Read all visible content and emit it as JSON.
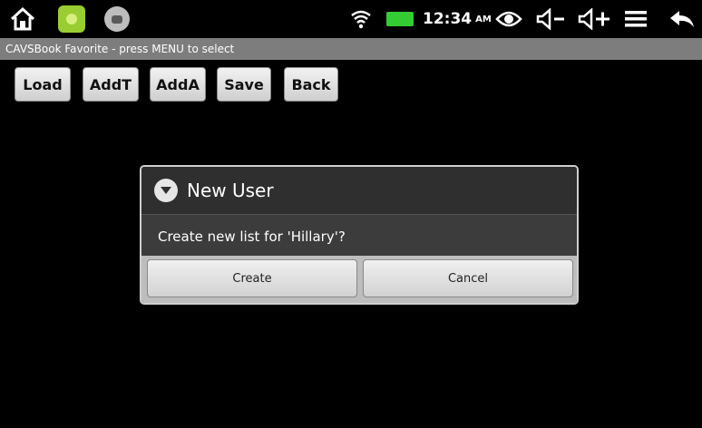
{
  "status_bar": {
    "time": "12:34",
    "ampm": "AM",
    "icons": [
      "home-icon",
      "android-icon",
      "camera-icon",
      "wifi-icon",
      "battery-icon",
      "eye-icon",
      "volume-down-icon",
      "volume-up-icon",
      "menu-icon",
      "back-icon"
    ]
  },
  "app": {
    "title": "CAVSBook Favorite - press MENU to select"
  },
  "toolbar": {
    "buttons": [
      "Load",
      "AddT",
      "AddA",
      "Save",
      "Back"
    ]
  },
  "dialog": {
    "title": "New User",
    "message": "Create new list for 'Hillary'?",
    "create_label": "Create",
    "cancel_label": "Cancel"
  },
  "colors": {
    "battery": "#33cc33",
    "android": "#9acd32",
    "titlebar": "#7d7d7d"
  }
}
